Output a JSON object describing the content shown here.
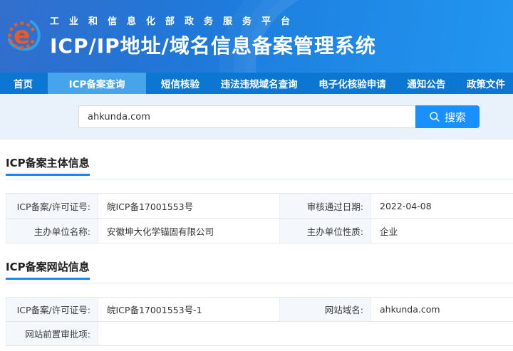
{
  "header": {
    "platform_title": "工业和信息化部政务服务平台",
    "system_title": "ICP/IP地址/域名信息备案管理系统",
    "logo_icon": "gear-e-logo"
  },
  "nav": {
    "items": [
      {
        "label": "首页",
        "active": false
      },
      {
        "label": "ICP备案查询",
        "active": true
      },
      {
        "label": "短信核验",
        "active": false
      },
      {
        "label": "违法违规域名查询",
        "active": false
      },
      {
        "label": "电子化核验申请",
        "active": false
      },
      {
        "label": "通知公告",
        "active": false
      },
      {
        "label": "政策文件",
        "active": false
      }
    ]
  },
  "search": {
    "value": "ahkunda.com",
    "button_label": "搜索",
    "icon": "search-icon"
  },
  "sections": [
    {
      "title": "ICP备案主体信息",
      "rows": [
        [
          {
            "label": "ICP备案/许可证号:",
            "value": "皖ICP备17001553号"
          },
          {
            "label": "审核通过日期:",
            "value": "2022-04-08"
          }
        ],
        [
          {
            "label": "主办单位名称:",
            "value": "安徽坤大化学锚固有限公司"
          },
          {
            "label": "主办单位性质:",
            "value": "企业"
          }
        ]
      ]
    },
    {
      "title": "ICP备案网站信息",
      "rows": [
        [
          {
            "label": "ICP备案/许可证号:",
            "value": "皖ICP备17001553号-1"
          },
          {
            "label": "网站域名:",
            "value": "ahkunda.com"
          }
        ],
        [
          {
            "label": "网站前置审批项:",
            "value": ""
          }
        ]
      ]
    }
  ],
  "colors": {
    "accent_blue": "#1890ff",
    "nav_bg": "#0b77d3",
    "nav_active_bg": "#47a4ea",
    "header_gradient_start": "#1c5fc7",
    "header_gradient_end": "#2196f0",
    "search_section_bg": "#e9f2fb",
    "label_cell_bg": "#f4f8fc",
    "title_underline": "#1786f9",
    "logo_orange": "#f4581c",
    "logo_blue": "#2ea0e8"
  }
}
